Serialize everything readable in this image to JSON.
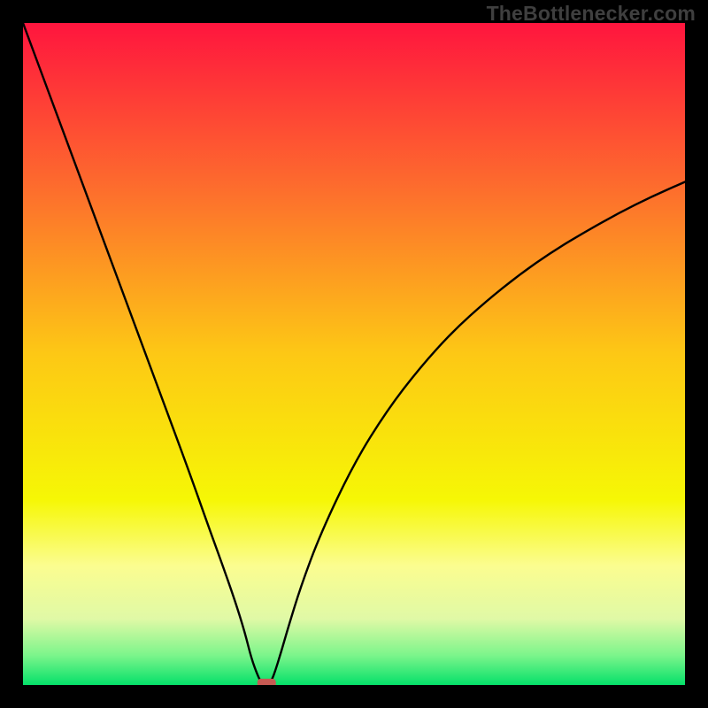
{
  "watermark": "TheBottlenecker.com",
  "chart_data": {
    "type": "line",
    "title": "",
    "xlabel": "",
    "ylabel": "",
    "xlim": [
      0,
      100
    ],
    "ylim": [
      0,
      100
    ],
    "background_gradient": {
      "stops": [
        {
          "pos": 0.0,
          "color": "#ff153e"
        },
        {
          "pos": 0.25,
          "color": "#fd6d2d"
        },
        {
          "pos": 0.5,
          "color": "#fdc815"
        },
        {
          "pos": 0.72,
          "color": "#f6f705"
        },
        {
          "pos": 0.82,
          "color": "#fbfd90"
        },
        {
          "pos": 0.9,
          "color": "#e0f9a6"
        },
        {
          "pos": 0.955,
          "color": "#7cf58b"
        },
        {
          "pos": 1.0,
          "color": "#05e06a"
        }
      ]
    },
    "series": [
      {
        "name": "bottleneck-curve",
        "color": "#000000",
        "points": [
          {
            "x": 0.0,
            "y": 100.0
          },
          {
            "x": 5.0,
            "y": 86.5
          },
          {
            "x": 10.0,
            "y": 73.0
          },
          {
            "x": 15.0,
            "y": 59.5
          },
          {
            "x": 20.0,
            "y": 46.0
          },
          {
            "x": 25.0,
            "y": 32.5
          },
          {
            "x": 28.0,
            "y": 24.0
          },
          {
            "x": 30.0,
            "y": 18.5
          },
          {
            "x": 32.0,
            "y": 12.8
          },
          {
            "x": 33.5,
            "y": 8.0
          },
          {
            "x": 34.5,
            "y": 4.0
          },
          {
            "x": 35.5,
            "y": 1.3
          },
          {
            "x": 36.0,
            "y": 0.4
          },
          {
            "x": 36.5,
            "y": 0.0
          },
          {
            "x": 37.0,
            "y": 0.0
          },
          {
            "x": 37.5,
            "y": 0.6
          },
          {
            "x": 38.0,
            "y": 1.8
          },
          {
            "x": 39.0,
            "y": 5.0
          },
          {
            "x": 40.0,
            "y": 8.5
          },
          {
            "x": 42.0,
            "y": 15.0
          },
          {
            "x": 45.0,
            "y": 23.0
          },
          {
            "x": 50.0,
            "y": 33.5
          },
          {
            "x": 55.0,
            "y": 41.5
          },
          {
            "x": 60.0,
            "y": 48.0
          },
          {
            "x": 65.0,
            "y": 53.5
          },
          {
            "x": 70.0,
            "y": 58.0
          },
          {
            "x": 75.0,
            "y": 62.0
          },
          {
            "x": 80.0,
            "y": 65.5
          },
          {
            "x": 85.0,
            "y": 68.5
          },
          {
            "x": 90.0,
            "y": 71.3
          },
          {
            "x": 95.0,
            "y": 73.8
          },
          {
            "x": 100.0,
            "y": 76.0
          }
        ]
      }
    ],
    "marker": {
      "name": "optimal-point",
      "x": 36.8,
      "y": 0.2,
      "color": "#c65a53",
      "shape": "rounded-rect",
      "w": 2.8,
      "h": 1.5
    }
  }
}
